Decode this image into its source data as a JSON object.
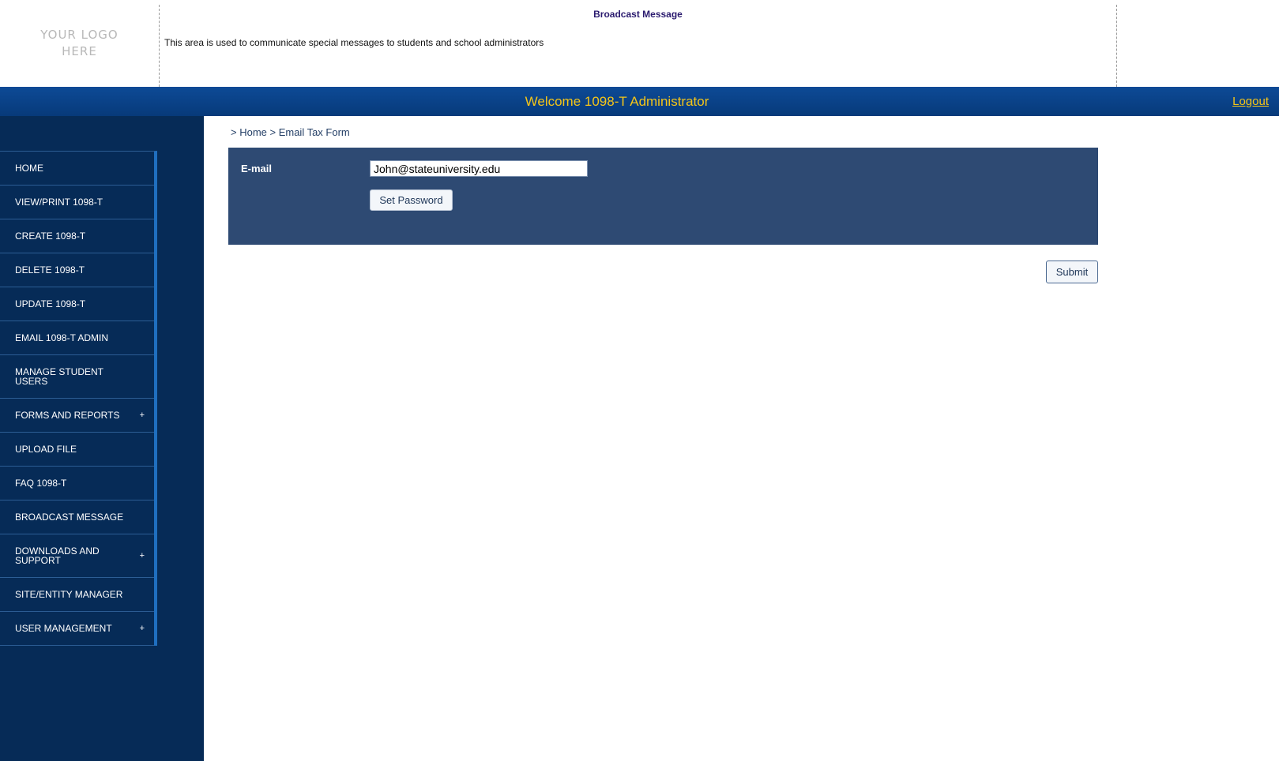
{
  "header": {
    "logo_text": "YOUR LOGO HERE",
    "broadcast_title": "Broadcast Message",
    "broadcast_text": "This area is used to communicate special messages to students and school administrators"
  },
  "welcome_bar": {
    "welcome_text": "Welcome 1098-T Administrator",
    "logout_label": "Logout"
  },
  "sidebar": {
    "items": [
      {
        "label": "HOME",
        "expandable": false
      },
      {
        "label": "VIEW/PRINT 1098-T",
        "expandable": false
      },
      {
        "label": "CREATE 1098-T",
        "expandable": false
      },
      {
        "label": "DELETE 1098-T",
        "expandable": false
      },
      {
        "label": "UPDATE 1098-T",
        "expandable": false
      },
      {
        "label": "EMAIL 1098-T ADMIN",
        "expandable": false
      },
      {
        "label": "MANAGE STUDENT USERS",
        "expandable": false
      },
      {
        "label": "FORMS AND REPORTS",
        "expandable": true
      },
      {
        "label": "UPLOAD FILE",
        "expandable": false
      },
      {
        "label": "FAQ 1098-T",
        "expandable": false
      },
      {
        "label": "BROADCAST MESSAGE",
        "expandable": false
      },
      {
        "label": "DOWNLOADS AND SUPPORT",
        "expandable": true
      },
      {
        "label": "SITE/ENTITY MANAGER",
        "expandable": false
      },
      {
        "label": "USER MANAGEMENT",
        "expandable": true
      }
    ],
    "expand_symbol": "+"
  },
  "main": {
    "breadcrumb": "> Home > Email Tax Form",
    "form": {
      "email_label": "E-mail",
      "email_value": "John@stateuniversity.edu",
      "set_password_label": "Set Password"
    },
    "submit_label": "Submit"
  },
  "colors": {
    "sidebar_bg": "#062b57",
    "welcome_bar_bg": "#0b4590",
    "accent_gold": "#f5c518",
    "form_panel_bg": "#2e4a73",
    "sidebar_active_border": "#1f6fc0"
  }
}
